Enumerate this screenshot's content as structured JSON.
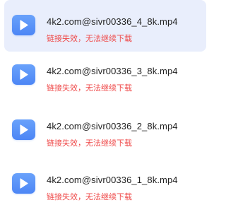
{
  "downloads": {
    "items": [
      {
        "filename": "4k2.com@sivr00336_4_8k.mp4",
        "status": "链接失效，无法继续下载",
        "icon": "video-play-icon",
        "selected": true
      },
      {
        "filename": "4k2.com@sivr00336_3_8k.mp4",
        "status": "链接失效，无法继续下载",
        "icon": "video-play-icon",
        "selected": false
      },
      {
        "filename": "4k2.com@sivr00336_2_8k.mp4",
        "status": "链接失效，无法继续下载",
        "icon": "video-play-icon",
        "selected": false
      },
      {
        "filename": "4k2.com@sivr00336_1_8k.mp4",
        "status": "链接失效，无法继续下载",
        "icon": "video-play-icon",
        "selected": false
      }
    ]
  },
  "colors": {
    "selected_background": "#e9eefc",
    "icon_blue": "#5b95f8",
    "status_red": "#ef4a4a",
    "filename_text": "#222222"
  }
}
